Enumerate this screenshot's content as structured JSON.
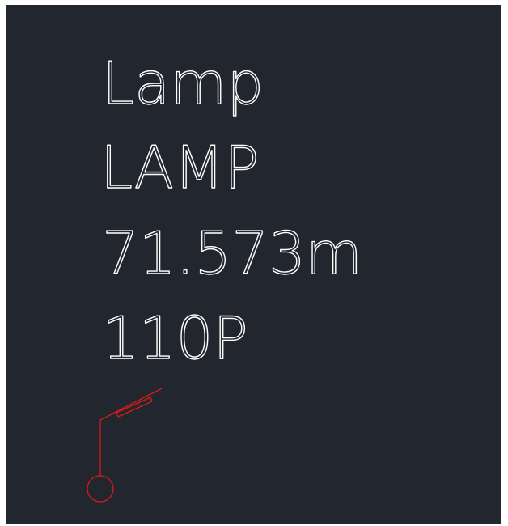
{
  "colors": {
    "background": "#22262e",
    "text": "#ffffff",
    "symbol": "#e01818"
  },
  "annotation": {
    "line1": "Lamp",
    "line2": "LAMP",
    "line3": "71.573m",
    "line4": "110P"
  },
  "symbol": {
    "icon": "street-lamp-icon"
  }
}
